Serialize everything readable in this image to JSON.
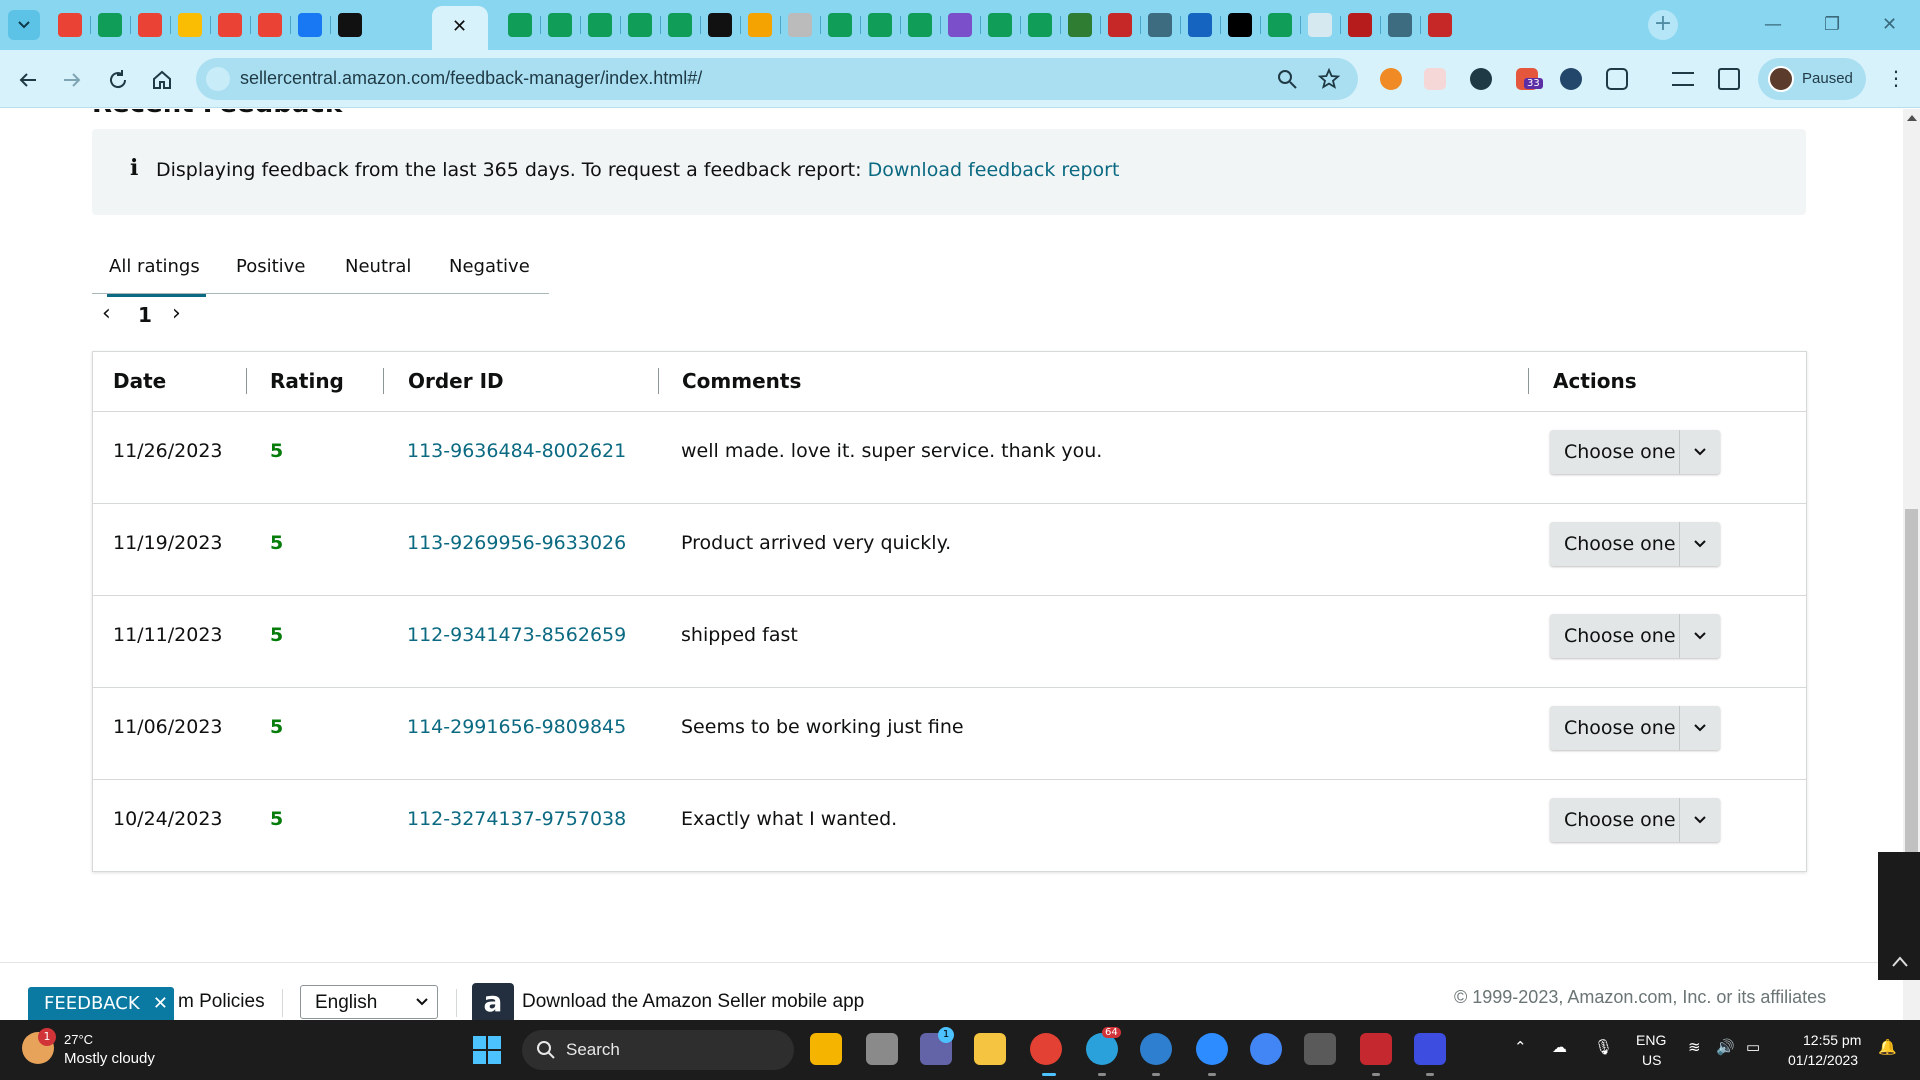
{
  "browser": {
    "url": "sellercentral.amazon.com/feedback-manager/index.html#/",
    "profile_label": "Paused",
    "active_tab_close": "✕",
    "tab_icons": [
      "gmail-icon",
      "sheets-icon",
      "gmail-icon",
      "drive-icon",
      "gmail-icon",
      "gmail-icon",
      "facebook-icon",
      "amazon-icon",
      "sheets-icon",
      "sheets-icon",
      "sheets-icon",
      "sheets-icon",
      "sheets-icon",
      "circle-icon",
      "pencil-icon",
      "grey-icon",
      "sheets-icon",
      "sheets-icon",
      "sheets-icon",
      "chat-icon",
      "sheets-icon",
      "sheets-icon",
      "n-icon",
      "vw-icon",
      "cloud-icon",
      "fish-icon",
      "nc-icon",
      "sheets-icon",
      "sysco-icon",
      "badge-icon",
      "cloud-icon",
      "vee-icon"
    ],
    "ext_badge": "33",
    "colors": {
      "tabstrip": "#88d6f0",
      "toolbar": "#d8f2fb"
    }
  },
  "page": {
    "section_title": "Recent Feedback",
    "info_text": "Displaying feedback from the last 365 days. To request a feedback report: ",
    "info_link": "Download feedback report",
    "rating_tabs": [
      "All ratings",
      "Positive",
      "Neutral",
      "Negative"
    ],
    "active_tab": "All ratings",
    "pager": {
      "prev": "‹",
      "page": "1",
      "next": "›"
    },
    "columns": [
      "Date",
      "Rating",
      "Order ID",
      "Comments",
      "Actions"
    ],
    "rows": [
      {
        "date": "11/26/2023",
        "rating": "5",
        "order_id": "113-9636484-8002621",
        "comment": "well made. love it. super service. thank you.",
        "action": "Choose one"
      },
      {
        "date": "11/19/2023",
        "rating": "5",
        "order_id": "113-9269956-9633026",
        "comment": "Product arrived very quickly.",
        "action": "Choose one"
      },
      {
        "date": "11/11/2023",
        "rating": "5",
        "order_id": "112-9341473-8562659",
        "comment": "shipped fast",
        "action": "Choose one"
      },
      {
        "date": "11/06/2023",
        "rating": "5",
        "order_id": "114-2991656-9809845",
        "comment": "Seems to be working just fine",
        "action": "Choose one"
      },
      {
        "date": "10/24/2023",
        "rating": "5",
        "order_id": "112-3274137-9757038",
        "comment": "Exactly what I wanted.",
        "action": "Choose one"
      }
    ],
    "colors": {
      "link": "#0b6a82",
      "rating": "#067d0b"
    }
  },
  "footer": {
    "feedback_btn": "FEEDBACK",
    "feedback_close": "✕",
    "policies": "m Policies",
    "language": "English",
    "app_text": "Download the Amazon Seller mobile app",
    "copyright": "© 1999-2023, Amazon.com, Inc. or its affiliates"
  },
  "taskbar": {
    "weather_temp": "27°C",
    "weather_desc": "Mostly cloudy",
    "weather_badge": "1",
    "search_label": "Search",
    "lang_top": "ENG",
    "lang_bottom": "US",
    "time": "12:55 pm",
    "date": "01/12/2023",
    "telegram_badge": "64",
    "teams_badge": "1"
  }
}
